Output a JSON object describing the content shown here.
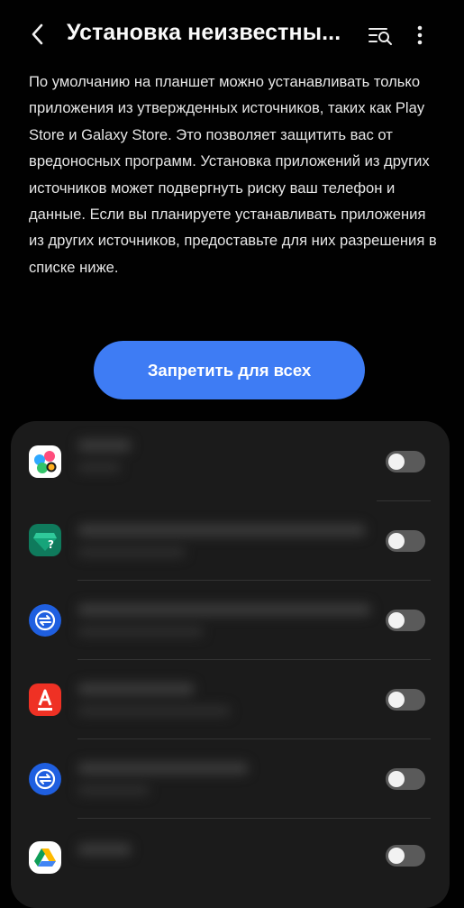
{
  "header": {
    "title": "Установка неизвестны...",
    "back_icon": "back-arrow-icon",
    "search_icon": "search-list-icon",
    "more_icon": "more-vertical-icon"
  },
  "description": "По умолчанию на планшет можно устанавливать только приложения из утвержденных источников, таких как Play Store и Galaxy Store. Это позволяет защитить вас от вредоносных программ. Установка приложений из других источников может подвергнуть риску ваш телефон и данные. Если вы планируете устанавливать приложения из других источников, предоставьте для них разрешения в списке ниже.",
  "block_all_button": "Запретить для всех",
  "accent_color": "#3e7cf4",
  "apps": [
    {
      "icon": "multicolor-dots-app-icon",
      "toggle_on": false
    },
    {
      "icon": "green-gem-question-app-icon",
      "toggle_on": false
    },
    {
      "icon": "blue-sync-app-icon",
      "toggle_on": false
    },
    {
      "icon": "red-letter-a-app-icon",
      "toggle_on": false
    },
    {
      "icon": "blue-sync-app-icon",
      "toggle_on": false
    },
    {
      "icon": "drive-triangle-app-icon",
      "toggle_on": false
    }
  ]
}
